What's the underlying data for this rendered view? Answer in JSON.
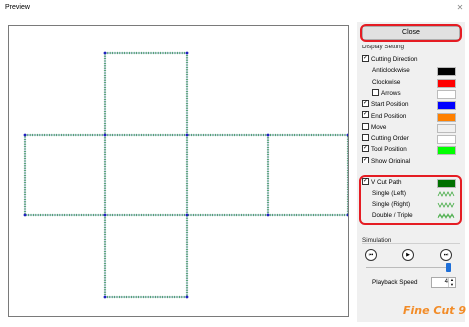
{
  "window": {
    "title": "Preview"
  },
  "panel": {
    "close_label": "Close",
    "display_setting_label": "Display Setting",
    "items": [
      {
        "label": "Cutting Direction",
        "checked": true,
        "indent": false
      },
      {
        "label": "Anticlockwise",
        "indent": true,
        "color": "#000000"
      },
      {
        "label": "Clockwise",
        "indent": true,
        "color": "#ff0000"
      },
      {
        "label": "Arrows",
        "checked": false,
        "indent": true,
        "color": "#ffffff"
      },
      {
        "label": "Start Position",
        "checked": true,
        "indent": false,
        "color": "#0000ff"
      },
      {
        "label": "End Position",
        "checked": true,
        "indent": false,
        "color": "#ff8000"
      },
      {
        "label": "Move",
        "checked": false,
        "indent": false,
        "color": "#f0f0f0"
      },
      {
        "label": "Cutting Order",
        "checked": false,
        "indent": false,
        "color": "#ffffff"
      },
      {
        "label": "Tool Position",
        "checked": true,
        "indent": false,
        "color": "#00ff00"
      },
      {
        "label": "Show Original",
        "checked": true,
        "indent": false,
        "color": "#c0c0c0"
      }
    ],
    "vcut": {
      "label": "V Cut Path",
      "checked": true,
      "color": "#007000",
      "single_left": "Single (Left)",
      "single_right": "Single (Right)",
      "double_triple": "Double / Triple"
    },
    "simulation_label": "Simulation",
    "playback_speed_label": "Playback Speed",
    "playback_speed_value": "4"
  },
  "logo_text": "Fine Cut 9",
  "colors": {
    "highlight": "#e51c23",
    "dotted_path": "#3da83d",
    "corner": "#1f1fbf"
  }
}
